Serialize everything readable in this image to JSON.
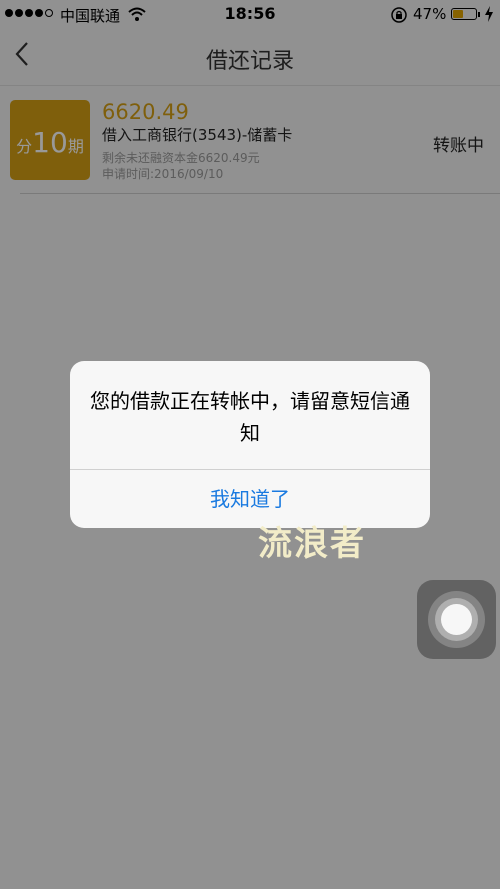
{
  "status_bar": {
    "carrier": "中国联通",
    "time": "18:56",
    "battery_percent": "47%",
    "battery_level": 0.47
  },
  "nav": {
    "back_icon": "chevron-left-icon",
    "title": "借还记录"
  },
  "record": {
    "badge_prefix": "分",
    "badge_number": "10",
    "badge_suffix": "期",
    "amount": "6620.49",
    "bank": "借入工商银行(3543)-储蓄卡",
    "remaining": "剩余未还融资本金6620.49元",
    "date": "申请时间:2016/09/10",
    "status": "转账中"
  },
  "alert": {
    "message": "您的借款正在转帐中，请留意短信通知",
    "button": "我知道了"
  },
  "watermark": "流浪者",
  "colors": {
    "accent": "#d49f15",
    "link": "#1a7ae0"
  }
}
